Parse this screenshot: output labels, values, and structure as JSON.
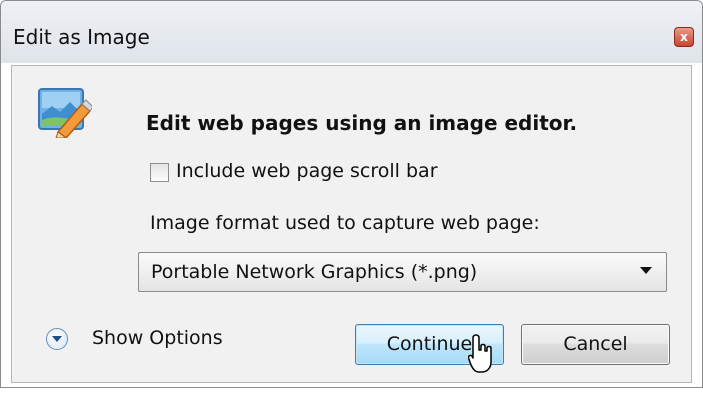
{
  "window": {
    "title": "Edit as Image",
    "close_glyph": "x"
  },
  "dialog": {
    "heading": "Edit web pages using an image editor.",
    "include_scrollbar": {
      "label": "Include web page scroll bar",
      "checked": false
    },
    "format": {
      "label": "Image format used to capture web page:",
      "selected": "Portable Network Graphics (*.png)"
    },
    "show_options_label": "Show Options",
    "continue_label": "Continue",
    "cancel_label": "Cancel"
  },
  "icons": {
    "app": "landscape-pencil-icon",
    "options": "chevron-down-circle-icon",
    "dropdown": "dropdown-arrow-icon",
    "cursor": "mouse-pointer-icon"
  }
}
